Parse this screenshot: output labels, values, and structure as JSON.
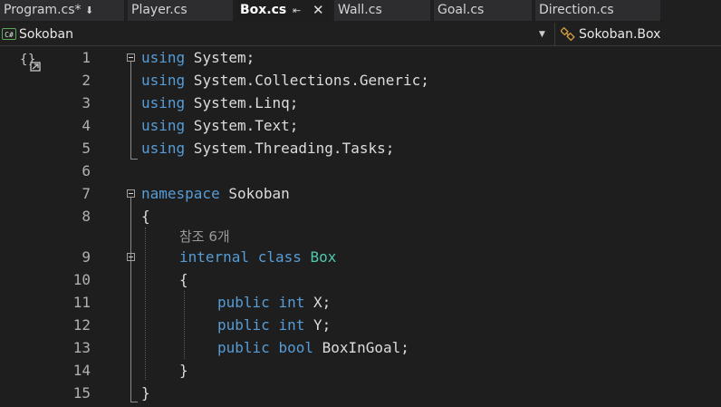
{
  "tabs": [
    {
      "label": "Program.cs*",
      "pinned": true,
      "active": false
    },
    {
      "label": "Player.cs",
      "active": false
    },
    {
      "label": "Box.cs",
      "pinned": true,
      "active": true
    },
    {
      "label": "Wall.cs",
      "active": false
    },
    {
      "label": "Goal.cs",
      "active": false
    },
    {
      "label": "Direction.cs",
      "active": false
    }
  ],
  "navbar": {
    "project_icon": "C#",
    "project": "Sokoban",
    "member": "Sokoban.Box"
  },
  "icons": {
    "pin": "pin-icon",
    "close": "close-icon",
    "project": "csharp-file-icon",
    "class": "class-icon",
    "scope": "scope-brackets-icon",
    "dropdown": "chevron-down-icon"
  },
  "editor": {
    "line_numbers": [
      "1",
      "2",
      "3",
      "4",
      "5",
      "6",
      "7",
      "8",
      "9",
      "10",
      "11",
      "12",
      "13",
      "14",
      "15"
    ],
    "lines": {
      "l1": {
        "kw": "using",
        "rest": " System;"
      },
      "l2": {
        "kw": "using",
        "rest": " System.Collections.Generic;"
      },
      "l3": {
        "kw": "using",
        "rest": " System.Linq;"
      },
      "l4": {
        "kw": "using",
        "rest": " System.Text;"
      },
      "l5": {
        "kw": "using",
        "rest": " System.Threading.Tasks;"
      },
      "l7": {
        "kw": "namespace",
        "rest": " Sokoban"
      },
      "l8": {
        "text": "{"
      },
      "l9": {
        "kw1": "internal",
        "kw2": "class",
        "name": "Box"
      },
      "l10": {
        "text": "{"
      },
      "l11": {
        "kw1": "public",
        "kw2": "int",
        "rest": " X;"
      },
      "l12": {
        "kw1": "public",
        "kw2": "int",
        "rest": " Y;"
      },
      "l13": {
        "kw1": "public",
        "kw2": "bool",
        "rest": " BoxInGoal;"
      },
      "l14": {
        "text": "}"
      },
      "l15": {
        "text": "}"
      }
    },
    "reference_hint": "참조 6개"
  },
  "colors": {
    "keyword": "#569cd6",
    "type_name": "#4ec9b0",
    "plain_text": "#dcdcdc",
    "line_number": "#b0b0b0",
    "background": "#1e1e1e"
  }
}
